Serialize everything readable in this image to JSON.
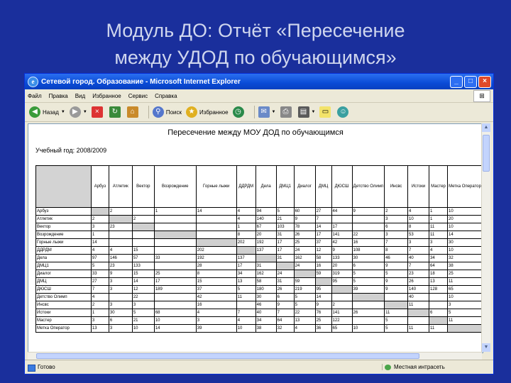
{
  "slide": {
    "title_line1": "Модуль ДО: Отчёт «Пересечение",
    "title_line2": "между УДОД по обучающимся»"
  },
  "window": {
    "title": "Сетевой город. Образование - Microsoft Internet Explorer",
    "controls": {
      "minimize": "_",
      "maximize": "□",
      "close": "×"
    }
  },
  "menu": [
    "Файл",
    "Правка",
    "Вид",
    "Избранное",
    "Сервис",
    "Справка"
  ],
  "toolbar": {
    "back": "Назад",
    "search": "Поиск",
    "favorites": "Избранное"
  },
  "report": {
    "title": "Пересечение между МОУ ДОД по обучающимся",
    "year_label": "Учебный год: 2008/2009"
  },
  "columns": [
    "Арбуз",
    "Атлетик",
    "Вектор",
    "Возрождение",
    "Горные лыжи",
    "ДДРДМ",
    "Дела",
    "ДМЦ1",
    "Диалог",
    "ДМЦ",
    "ДЮСШ",
    "Детство Олимп",
    "Инсвс",
    "Истоки",
    "Мастер",
    "Метка Оператор"
  ],
  "rows": [
    {
      "label": "Арбуз",
      "cells": [
        "",
        "2",
        "",
        "1",
        "14",
        "4",
        "94",
        "5",
        "60",
        "27",
        "44",
        "9",
        "2",
        "4",
        "1",
        "10"
      ]
    },
    {
      "label": "Атлетик",
      "cells": [
        "2",
        "",
        "2",
        "",
        "",
        "4",
        "140",
        "21",
        "9",
        "7",
        "",
        "",
        "3",
        "10",
        "1",
        "20"
      ]
    },
    {
      "label": "Вектор",
      "cells": [
        "3",
        "23",
        "",
        "",
        "",
        "1",
        "67",
        "103",
        "78",
        "14",
        "17",
        "",
        "6",
        "8",
        "11",
        "10"
      ]
    },
    {
      "label": "Возрождение",
      "cells": [
        "1",
        "",
        "",
        "",
        "",
        "8",
        "20",
        "31",
        "26",
        "17",
        "141",
        "22",
        "3",
        "53",
        "11",
        "14"
      ]
    },
    {
      "label": "Горные лыжи",
      "cells": [
        "14",
        "",
        "",
        "",
        "",
        "202",
        "192",
        "17",
        "25",
        "37",
        "42",
        "16",
        "7",
        "3",
        "3",
        "30"
      ]
    },
    {
      "label": "ДДРДМ",
      "cells": [
        "4",
        "4",
        "15",
        "",
        "202",
        "",
        "137",
        "17",
        "24",
        "12",
        "9",
        "108",
        "8",
        "7",
        "4",
        "10"
      ]
    },
    {
      "label": "Дела",
      "cells": [
        "97",
        "146",
        "57",
        "33",
        "192",
        "137",
        "",
        "31",
        "162",
        "58",
        "133",
        "30",
        "46",
        "40",
        "34",
        "32"
      ]
    },
    {
      "label": "ДМЦ1",
      "cells": [
        "5",
        "23",
        "133",
        "",
        "28",
        "17",
        "31",
        "",
        "24",
        "16",
        "20",
        "6",
        "9",
        "7",
        "64",
        "38"
      ]
    },
    {
      "label": "Диалог",
      "cells": [
        "33",
        "9",
        "15",
        "25",
        "8",
        "34",
        "162",
        "24",
        "",
        "59",
        "319",
        "5",
        "5",
        "23",
        "18",
        "25"
      ]
    },
    {
      "label": "ДМЦ",
      "cells": [
        "27",
        "3",
        "14",
        "17",
        "15",
        "13",
        "58",
        "31",
        "59",
        "",
        "95",
        "5",
        "9",
        "26",
        "13",
        "11"
      ]
    },
    {
      "label": "ДЮСШ",
      "cells": [
        "7",
        "3",
        "12",
        "189",
        "37",
        "5",
        "180",
        "26",
        "219",
        "95",
        "",
        "39",
        "9",
        "140",
        "128",
        "65"
      ]
    },
    {
      "label": "Детство Олимп",
      "cells": [
        "4",
        "",
        "22",
        "",
        "42",
        "11",
        "30",
        "6",
        "5",
        "14",
        "",
        "",
        "",
        "40",
        "",
        "10"
      ]
    },
    {
      "label": "Инсвс",
      "cells": [
        "2",
        "3",
        "3",
        "",
        "16",
        "",
        "46",
        "9",
        "5",
        "9",
        "2",
        "",
        "",
        "11",
        "",
        "3"
      ]
    },
    {
      "label": "Истоки",
      "cells": [
        "1",
        "30",
        "5",
        "68",
        "4",
        "7",
        "40",
        "7",
        "22",
        "76",
        "141",
        "26",
        "11",
        "",
        "6",
        "5"
      ]
    },
    {
      "label": "Мастер",
      "cells": [
        "3",
        "6",
        "21",
        "10",
        "3",
        "4",
        "34",
        "64",
        "13",
        "25",
        "122",
        "",
        "5",
        "",
        "",
        "11"
      ]
    },
    {
      "label": "Метка Оператор",
      "cells": [
        "13",
        "3",
        "10",
        "14",
        "39",
        "10",
        "38",
        "32",
        "4",
        "36",
        "65",
        "10",
        "5",
        "11",
        "11",
        ""
      ]
    }
  ],
  "status": {
    "left": "Готово",
    "zone": "Местная интрасеть"
  }
}
